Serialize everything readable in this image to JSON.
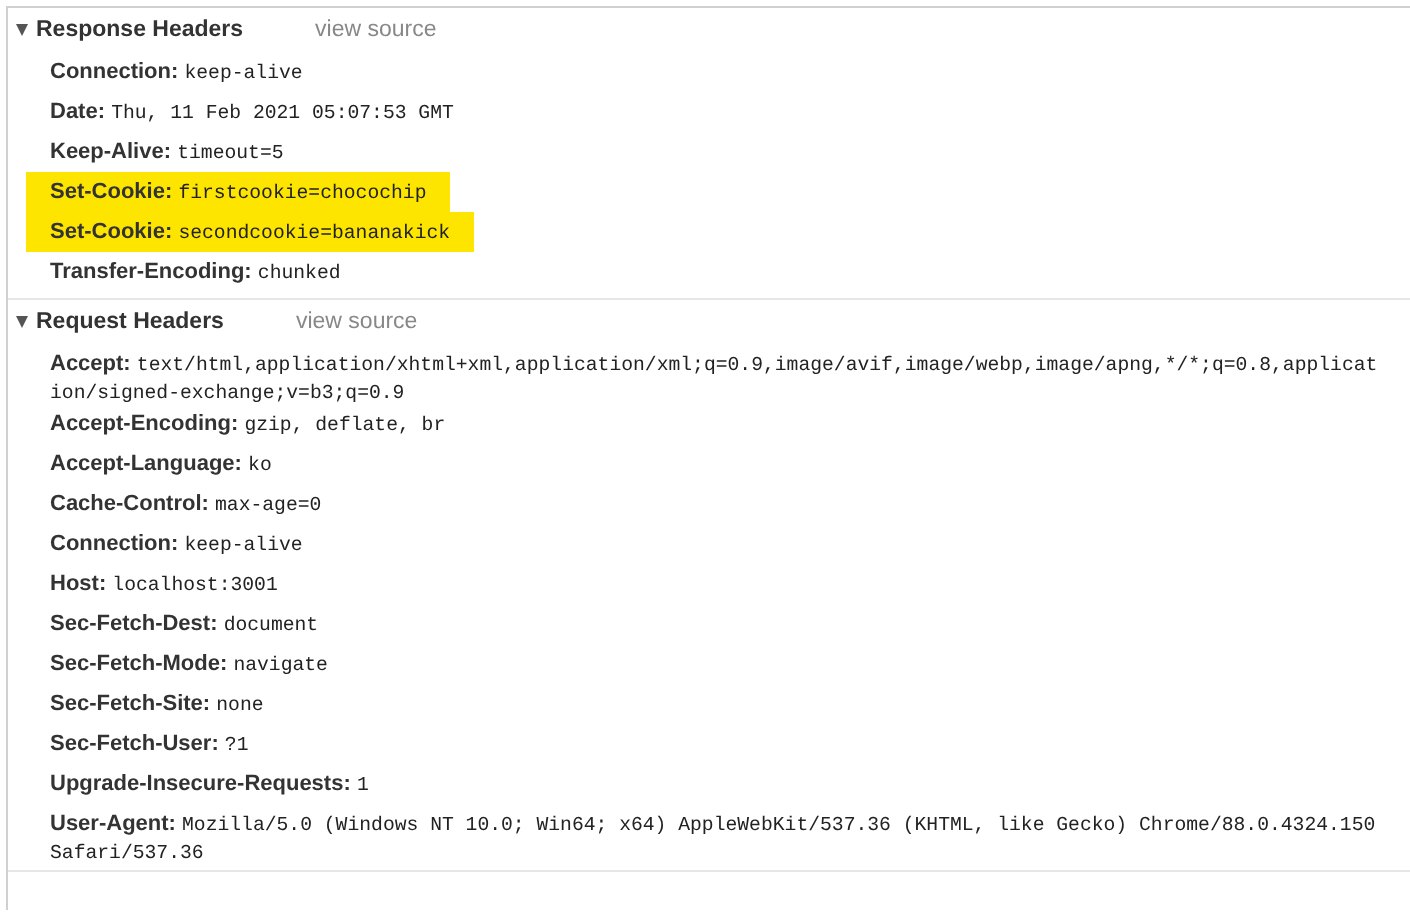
{
  "sections": [
    {
      "title": "Response Headers",
      "expanded": true,
      "link": "view source",
      "headers": [
        {
          "name": "Connection:",
          "value": "keep-alive",
          "highlighted": false
        },
        {
          "name": "Date:",
          "value": "Thu, 11 Feb 2021 05:07:53 GMT",
          "highlighted": false
        },
        {
          "name": "Keep-Alive:",
          "value": "timeout=5",
          "highlighted": false
        },
        {
          "name": "Set-Cookie:",
          "value": "firstcookie=chocochip",
          "highlighted": true
        },
        {
          "name": "Set-Cookie:",
          "value": "secondcookie=bananakick",
          "highlighted": true
        },
        {
          "name": "Transfer-Encoding:",
          "value": "chunked",
          "highlighted": false
        }
      ]
    },
    {
      "title": "Request Headers",
      "expanded": true,
      "link": "view source",
      "headers": [
        {
          "name": "Accept:",
          "value": "text/html,application/xhtml+xml,application/xml;q=0.9,image/avif,image/webp,image/apng,*/*;q=0.8,application/signed-exchange;v=b3;q=0.9",
          "highlighted": false
        },
        {
          "name": "Accept-Encoding:",
          "value": "gzip, deflate, br",
          "highlighted": false
        },
        {
          "name": "Accept-Language:",
          "value": "ko",
          "highlighted": false
        },
        {
          "name": "Cache-Control:",
          "value": "max-age=0",
          "highlighted": false
        },
        {
          "name": "Connection:",
          "value": "keep-alive",
          "highlighted": false
        },
        {
          "name": "Host:",
          "value": "localhost:3001",
          "highlighted": false
        },
        {
          "name": "Sec-Fetch-Dest:",
          "value": "document",
          "highlighted": false
        },
        {
          "name": "Sec-Fetch-Mode:",
          "value": "navigate",
          "highlighted": false
        },
        {
          "name": "Sec-Fetch-Site:",
          "value": "none",
          "highlighted": false
        },
        {
          "name": "Sec-Fetch-User:",
          "value": "?1",
          "highlighted": false
        },
        {
          "name": "Upgrade-Insecure-Requests:",
          "value": "1",
          "highlighted": false
        },
        {
          "name": "User-Agent:",
          "value": "Mozilla/5.0 (Windows NT 10.0; Win64; x64) AppleWebKit/537.36 (KHTML, like Gecko) Chrome/88.0.4324.150 Safari/537.36",
          "highlighted": false
        }
      ]
    }
  ]
}
